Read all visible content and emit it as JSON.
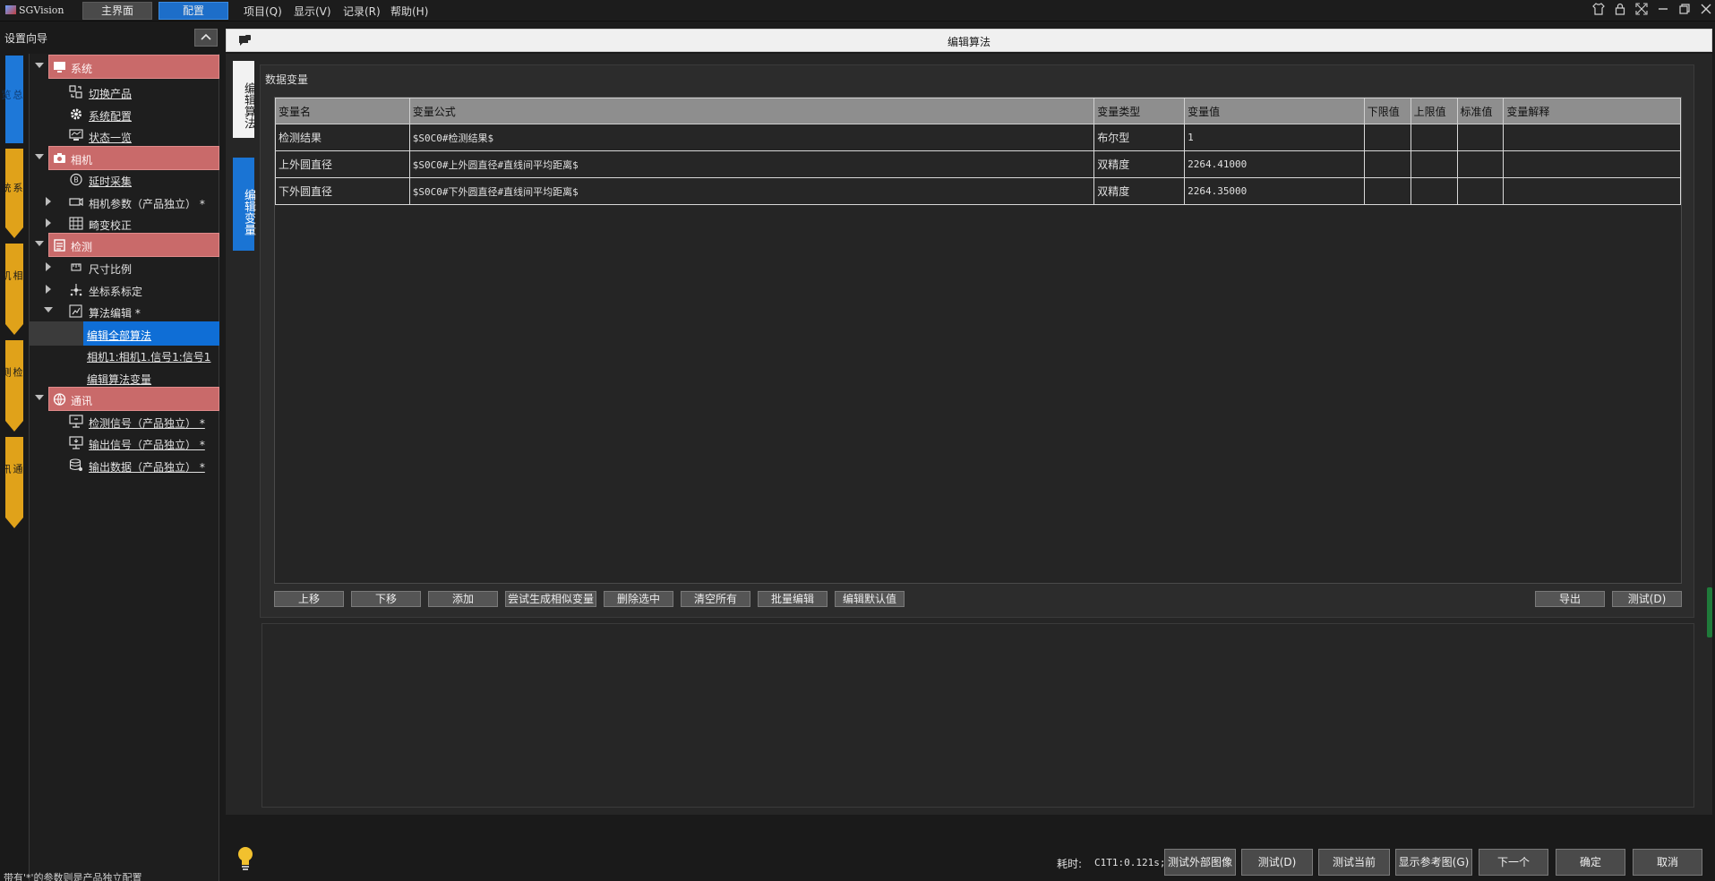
{
  "app": {
    "title": "SGVision",
    "top_tabs": [
      {
        "label": "主界面",
        "active": false
      },
      {
        "label": "配置",
        "active": true
      }
    ],
    "menu": [
      "项目(Q)",
      "显示(V)",
      "记录(R)",
      "帮助(H)"
    ]
  },
  "nav": {
    "header": "设置向导",
    "rail": [
      "总览",
      "系统",
      "相机",
      "检测",
      "通讯"
    ],
    "tree": {
      "system": {
        "label": "系统",
        "children": [
          "切换产品",
          "系统配置",
          "状态一览"
        ]
      },
      "camera": {
        "label": "相机",
        "children": [
          "延时采集",
          "相机参数（产品独立） *",
          "畸变校正"
        ]
      },
      "detect": {
        "label": "检测",
        "children": [
          "尺寸比例",
          "坐标系标定",
          "算法编辑 *"
        ],
        "sub": [
          "编辑全部算法",
          "相机1:相机1.信号1:信号1",
          "编辑算法变量"
        ]
      },
      "comm": {
        "label": "通讯",
        "children": [
          "检测信号（产品独立） *",
          "输出信号（产品独立） *",
          "输出数据（产品独立） *"
        ]
      }
    },
    "footnote": "带有'*'的参数则是产品独立配置"
  },
  "main": {
    "header_title": "编辑算法",
    "vtabs": [
      "编辑算法",
      "编辑变量"
    ],
    "section_title": "数据变量",
    "columns": [
      "变量名",
      "变量公式",
      "变量类型",
      "变量值",
      "下限值",
      "上限值",
      "标准值",
      "变量解释"
    ],
    "rows": [
      [
        "检测结果",
        "$S0C0#检测结果$",
        "布尔型",
        "1",
        "",
        "",
        "",
        ""
      ],
      [
        "上外圆直径",
        "$S0C0#上外圆直径#直线间平均距离$",
        "双精度",
        "2264.41000",
        "",
        "",
        "",
        ""
      ],
      [
        "下外圆直径",
        "$S0C0#下外圆直径#直线间平均距离$",
        "双精度",
        "2264.35000",
        "",
        "",
        "",
        ""
      ]
    ],
    "buttons": [
      "上移",
      "下移",
      "添加",
      "尝试生成相似变量",
      "删除选中",
      "清空所有",
      "批量编辑",
      "编辑默认值"
    ],
    "export_label": "导出",
    "test_label": "测试(D)"
  },
  "bottom": {
    "timing_label": "耗时:",
    "timing_value": "C1T1:0.121s;",
    "buttons": [
      "测试外部图像",
      "测试(D)",
      "测试当前",
      "显示参考图(G)",
      "下一个",
      "确定",
      "取消"
    ]
  },
  "colors": {
    "accent_blue": "#1d6ec9",
    "category_red": "#c96a6a",
    "rail_orange": "#e0a21a"
  }
}
